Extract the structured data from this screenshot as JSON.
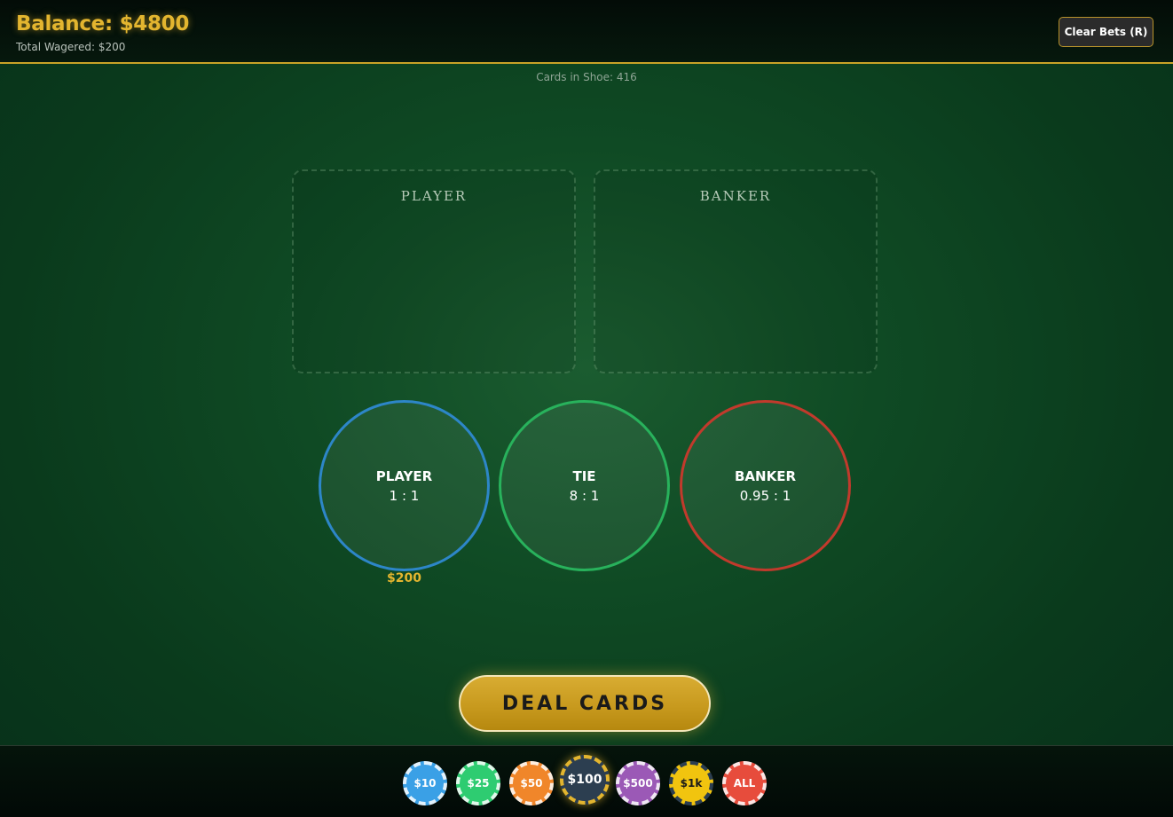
{
  "header": {
    "balance": "Balance: $4800",
    "total_wagered": "Total Wagered: $200",
    "clear_bets_label": "Clear Bets (R)"
  },
  "table": {
    "cards_in_shoe": "Cards in Shoe: 416",
    "player_hand_title": "PLAYER",
    "banker_hand_title": "BANKER"
  },
  "bets": {
    "player": {
      "name": "PLAYER",
      "odds": "1 : 1",
      "amount": "$200"
    },
    "tie": {
      "name": "TIE",
      "odds": "8 : 1"
    },
    "banker": {
      "name": "BANKER",
      "odds": "0.95 : 1"
    }
  },
  "deal_label": "DEAL CARDS",
  "chips": [
    {
      "label": "$10",
      "color": "#3aa0e6"
    },
    {
      "label": "$25",
      "color": "#2ecc71"
    },
    {
      "label": "$50",
      "color": "#f0862a"
    },
    {
      "label": "$100",
      "color": "#2c3e50",
      "selected": true
    },
    {
      "label": "$500",
      "color": "#9b59b6"
    },
    {
      "label": "$1k",
      "color": "#f1c40f",
      "dark_text": true
    },
    {
      "label": "ALL",
      "color": "#e74c3c"
    }
  ]
}
